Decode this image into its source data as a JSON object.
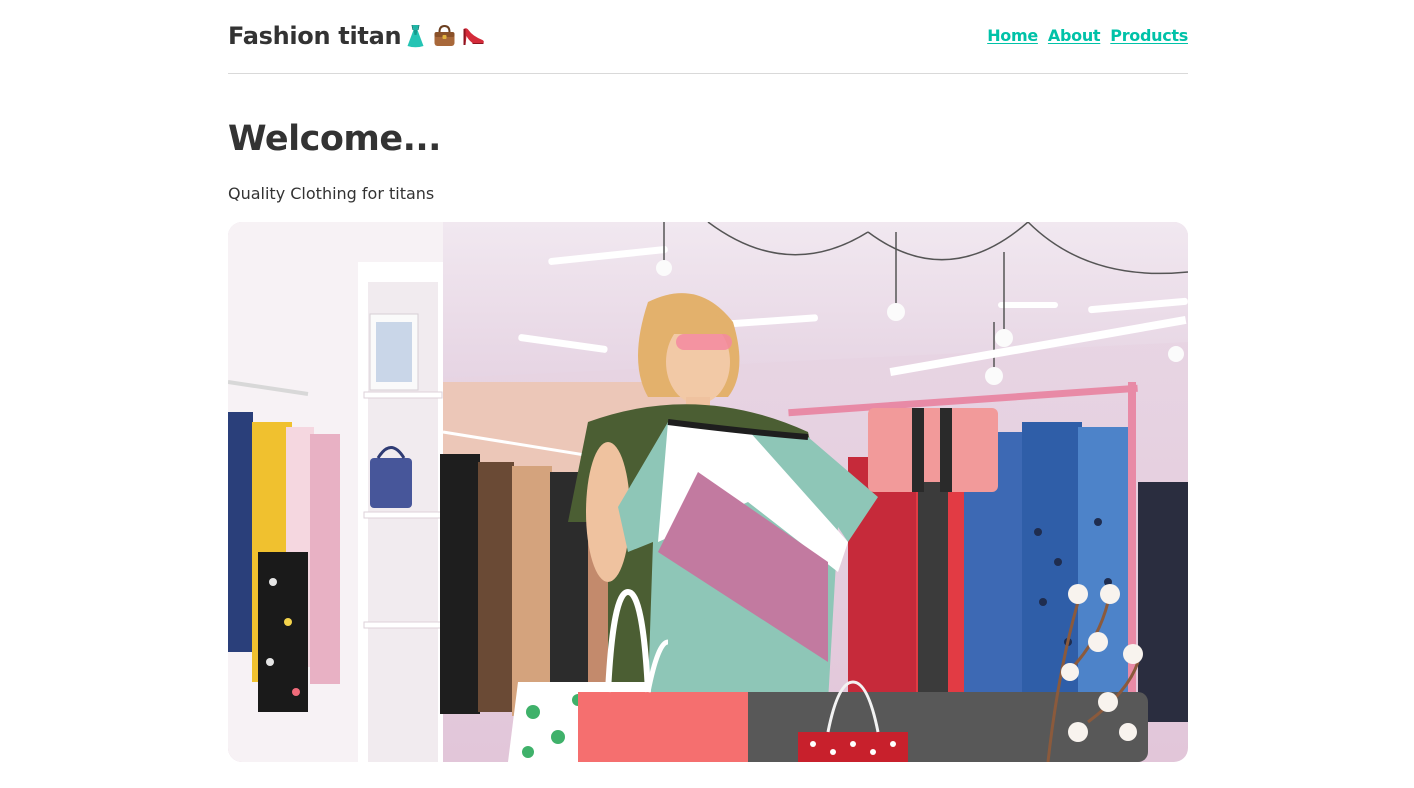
{
  "header": {
    "brand": "Fashion titan",
    "brand_icons": [
      "dress-icon",
      "handbag-icon",
      "high-heel-icon"
    ],
    "nav": [
      {
        "label": "Home"
      },
      {
        "label": "About"
      },
      {
        "label": "Products"
      }
    ]
  },
  "main": {
    "title": "Welcome...",
    "subtitle": "Quality Clothing for titans"
  },
  "colors": {
    "accent": "#00c2a8",
    "text": "#333333",
    "divider": "#d9d9d9"
  }
}
